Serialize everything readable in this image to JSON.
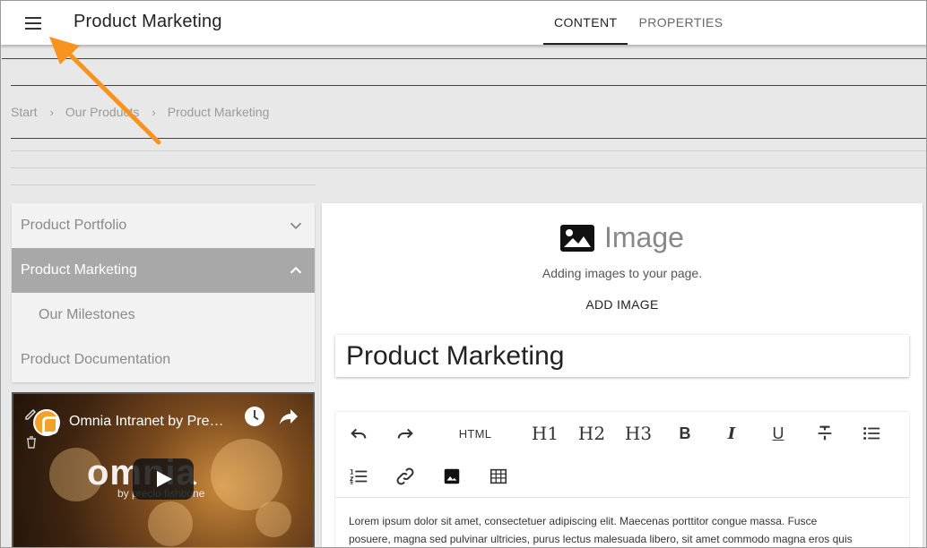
{
  "app": {
    "title": "Product Marketing",
    "tabs": [
      {
        "label": "CONTENT",
        "active": true
      },
      {
        "label": "PROPERTIES",
        "active": false
      }
    ]
  },
  "breadcrumb": [
    "Start",
    "Our Products",
    "Product Marketing"
  ],
  "leftnav": {
    "items": [
      {
        "label": "Product Portfolio",
        "state": "collapsed"
      },
      {
        "label": "Product Marketing",
        "state": "expanded-active"
      },
      {
        "label": "Our Milestones",
        "state": "child"
      },
      {
        "label": "Product Documentation",
        "state": "leaf"
      }
    ]
  },
  "video": {
    "title": "Omnia Intranet by Pre…",
    "brand": "omnia",
    "brand_sub": "by precio fishbone"
  },
  "image_block": {
    "heading": "Image",
    "description": "Adding images to your page.",
    "action": "ADD IMAGE"
  },
  "page_title_value": "Product Marketing",
  "editor": {
    "toolbar": {
      "html": "HTML",
      "h1": "H1",
      "h2": "H2",
      "h3": "H3",
      "bold": "B",
      "italic": "I",
      "underline": "U"
    },
    "body_line1": "Lorem ipsum dolor sit amet, consectetuer adipiscing elit. Maecenas porttitor congue massa. Fusce",
    "body_line2": "posuere, magna sed pulvinar ultricies, purus lectus malesuada libero, sit amet commodo magna eros quis"
  },
  "colors": {
    "accent_arrow": "#f7931e",
    "nav_active_bg": "#a8a8a8"
  }
}
